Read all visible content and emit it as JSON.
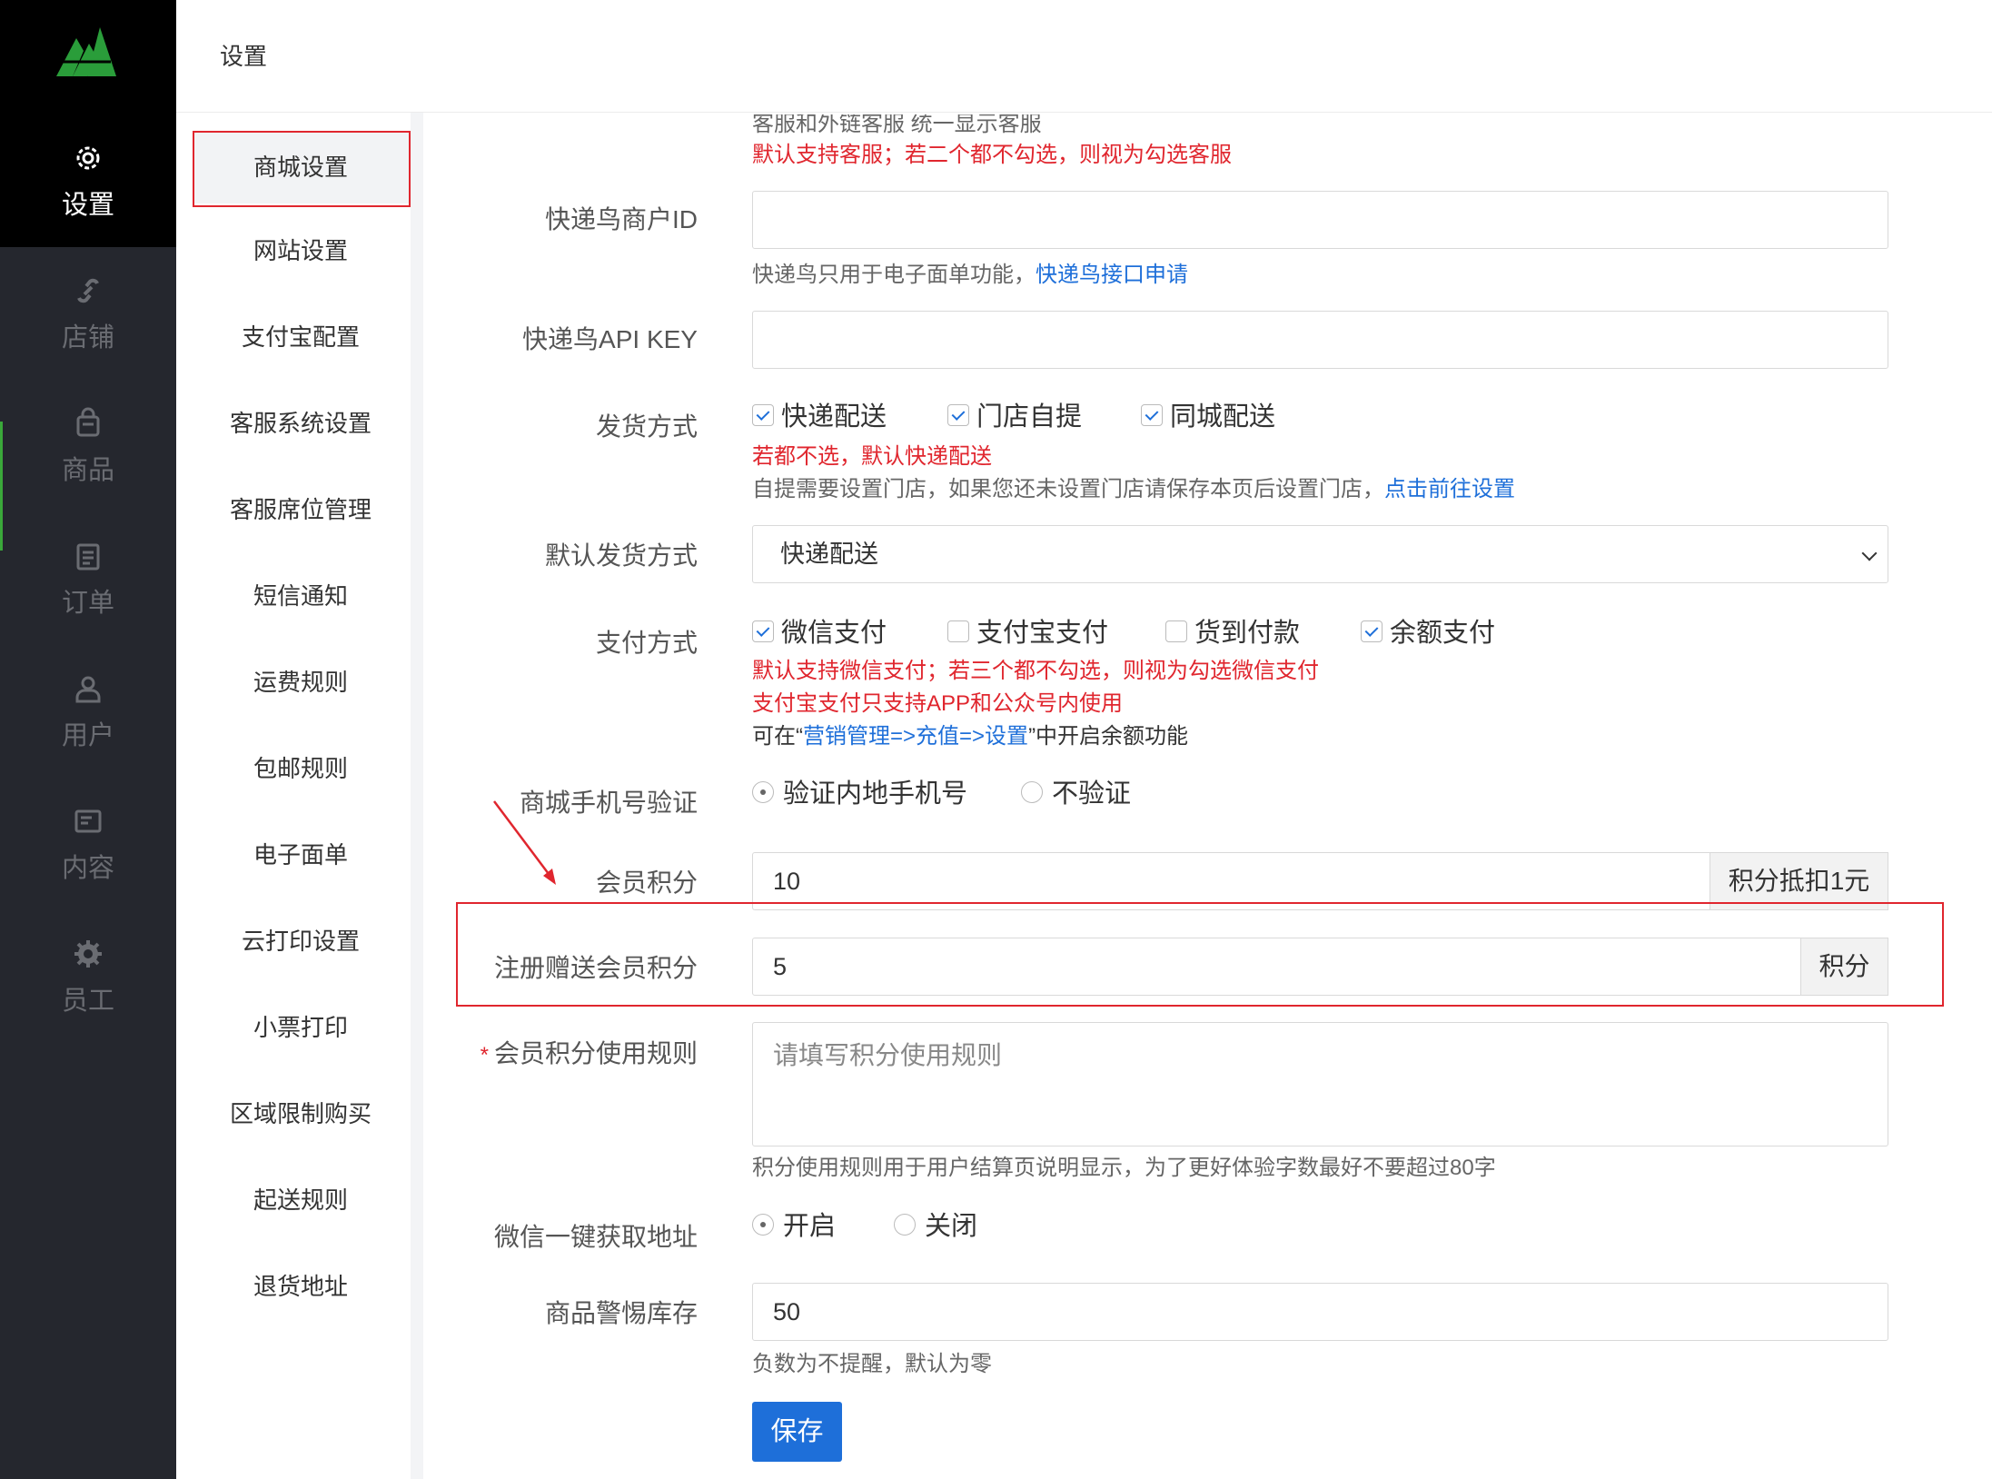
{
  "nav": {
    "items": [
      {
        "label": "设置",
        "icon": "gear-icon",
        "active": true
      },
      {
        "label": "店铺",
        "icon": "link-icon",
        "active": false
      },
      {
        "label": "商品",
        "icon": "bag-icon",
        "active": false
      },
      {
        "label": "订单",
        "icon": "clipboard-icon",
        "active": false
      },
      {
        "label": "用户",
        "icon": "user-icon",
        "active": false
      },
      {
        "label": "内容",
        "icon": "content-icon",
        "active": false
      },
      {
        "label": "员工",
        "icon": "staff-gear-icon",
        "active": false
      }
    ]
  },
  "header": {
    "title": "设置"
  },
  "submenu": {
    "items": [
      "商城设置",
      "网站设置",
      "支付宝配置",
      "客服系统设置",
      "客服席位管理",
      "短信通知",
      "运费规则",
      "包邮规则",
      "电子面单",
      "云打印设置",
      "小票打印",
      "区域限制购买",
      "起送规则",
      "退货地址"
    ],
    "active": "商城设置"
  },
  "form": {
    "top_help_cut": "客服和外链客服 统一显示客服",
    "top_help_red": "默认支持客服；若二个都不勾选，则视为勾选客服",
    "kdn_id": {
      "label": "快递鸟商户ID",
      "value": "",
      "help_prefix": "快递鸟只用于电子面单功能，",
      "help_link": "快递鸟接口申请"
    },
    "kdn_key": {
      "label": "快递鸟API KEY",
      "value": ""
    },
    "delivery": {
      "label": "发货方式",
      "options": [
        {
          "text": "快递配送",
          "checked": true
        },
        {
          "text": "门店自提",
          "checked": true
        },
        {
          "text": "同城配送",
          "checked": true
        }
      ],
      "help_red": "若都不选，默认快递配送",
      "help_prefix": "自提需要设置门店，如果您还未设置门店请保存本页后设置门店，",
      "help_link": "点击前往设置"
    },
    "default_delivery": {
      "label": "默认发货方式",
      "value": "快递配送"
    },
    "payment": {
      "label": "支付方式",
      "options": [
        {
          "text": "微信支付",
          "checked": true
        },
        {
          "text": "支付宝支付",
          "checked": false
        },
        {
          "text": "货到付款",
          "checked": false
        },
        {
          "text": "余额支付",
          "checked": true
        }
      ],
      "help_red1": "默认支持微信支付；若三个都不勾选，则视为勾选微信支付",
      "help_red2": "支付宝支付只支持APP和公众号内使用",
      "help_prefix": "可在“",
      "help_link": "营销管理=>充值=>设置",
      "help_suffix": "”中开启余额功能"
    },
    "phone_verify": {
      "label": "商城手机号验证",
      "options": [
        {
          "text": "验证内地手机号",
          "selected": true
        },
        {
          "text": "不验证",
          "selected": false
        }
      ]
    },
    "points": {
      "label": "会员积分",
      "value": "10",
      "addon": "积分抵扣1元"
    },
    "register_points": {
      "label": "注册赠送会员积分",
      "value": "5",
      "addon": "积分"
    },
    "points_rule": {
      "label": "会员积分使用规则",
      "required_mark": "*",
      "placeholder": "请填写积分使用规则",
      "help": "积分使用规则用于用户结算页说明显示，为了更好体验字数最好不要超过80字"
    },
    "wechat_address": {
      "label": "微信一键获取地址",
      "options": [
        {
          "text": "开启",
          "selected": true
        },
        {
          "text": "关闭",
          "selected": false
        }
      ]
    },
    "stock_alert": {
      "label": "商品警惕库存",
      "value": "50",
      "help": "负数为不提醒，默认为零"
    },
    "save_label": "保存"
  },
  "colors": {
    "accent": "#1e6fd9",
    "danger": "#e0262e",
    "nav_bg": "#25272e",
    "brand": "#3aa83a"
  }
}
